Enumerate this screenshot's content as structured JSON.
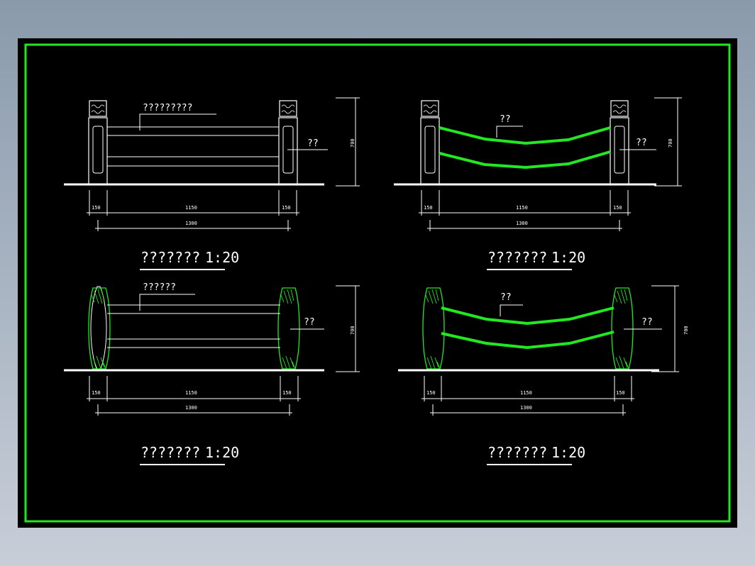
{
  "colors": {
    "frame": "#22e822",
    "background": "#000000",
    "line": "#ffffff"
  },
  "views": [
    {
      "callout_main": "?????????",
      "callout_post": "??",
      "title": "???????",
      "scale": "1:20",
      "dims": {
        "left": "150",
        "middle": "1150",
        "right": "150",
        "total": "1300",
        "height": "700"
      }
    },
    {
      "callout_main": "??",
      "callout_post": "??",
      "title": "???????",
      "scale": "1:20",
      "dims": {
        "left": "150",
        "middle": "1150",
        "right": "150",
        "total": "1300",
        "height": "700"
      }
    },
    {
      "callout_main": "??????",
      "callout_post": "??",
      "title": "???????",
      "scale": "1:20",
      "dims": {
        "left": "150",
        "middle": "1150",
        "right": "150",
        "total": "1300",
        "height": "700"
      }
    },
    {
      "callout_main": "??",
      "callout_post": "??",
      "title": "???????",
      "scale": "1:20",
      "dims": {
        "left": "150",
        "middle": "1150",
        "right": "150",
        "total": "1300",
        "height": "700"
      }
    }
  ]
}
